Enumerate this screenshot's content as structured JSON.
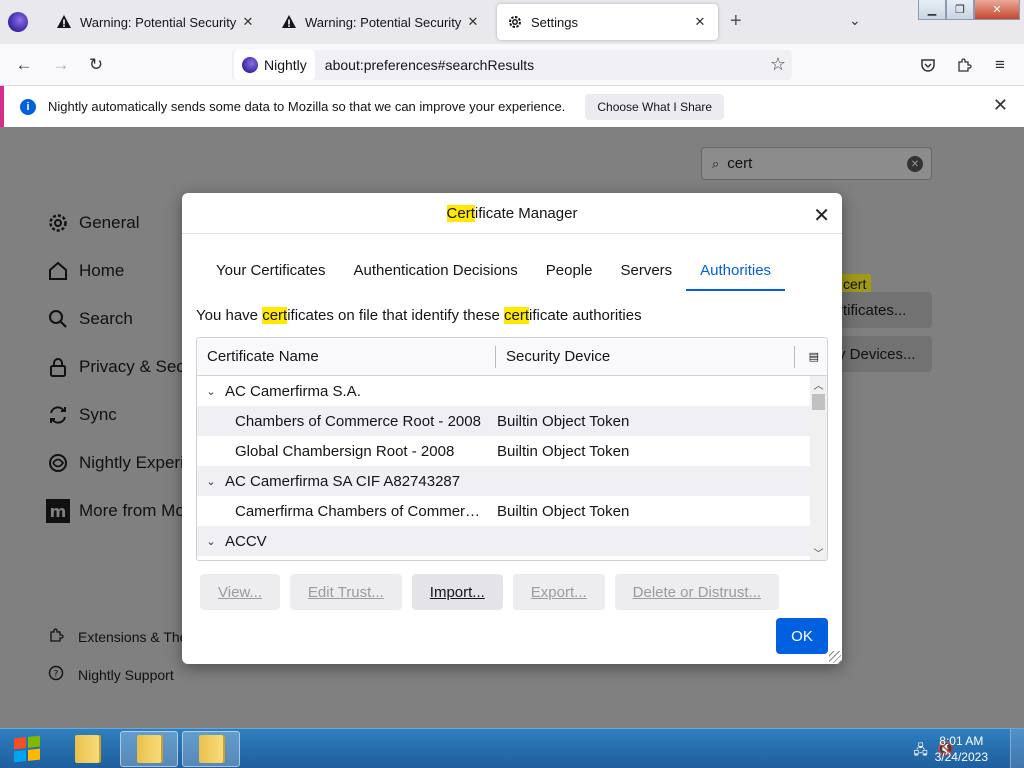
{
  "tabs": [
    {
      "title": "Warning: Potential Security Risk Ahead",
      "icon": "warning-icon"
    },
    {
      "title": "Warning: Potential Security Risk Ahead",
      "icon": "warning-icon"
    },
    {
      "title": "Settings",
      "icon": "gear-icon",
      "active": true
    }
  ],
  "navbar": {
    "identity_label": "Nightly",
    "url": "about:preferences#searchResults"
  },
  "notification": {
    "text": "Nightly automatically sends some data to Mozilla so that we can improve your experience.",
    "button": "Choose What I Share"
  },
  "settings": {
    "search_value": "cert",
    "categories": [
      {
        "label": "General",
        "icon": "gear-icon"
      },
      {
        "label": "Home",
        "icon": "home-icon"
      },
      {
        "label": "Search",
        "icon": "search-icon"
      },
      {
        "label": "Privacy & Secu",
        "icon": "lock-icon"
      },
      {
        "label": "Sync",
        "icon": "sync-icon"
      },
      {
        "label": "Nightly Experin",
        "icon": "flask-icon"
      },
      {
        "label": "More from Mo",
        "icon": "mozilla-icon"
      }
    ],
    "footer": [
      {
        "label": "Extensions & The",
        "icon": "puzzle-icon"
      },
      {
        "label": "Nightly Support",
        "icon": "help-icon"
      }
    ],
    "bg_badge": "cert",
    "bg_view_certs": "rtificates...",
    "bg_devices": "y Devices..."
  },
  "dialog": {
    "title_highlight": "Cert",
    "title_rest": "ificate Manager",
    "tabs": [
      "Your Certificates",
      "Authentication Decisions",
      "People",
      "Servers",
      "Authorities"
    ],
    "active_tab": "Authorities",
    "desc": {
      "p1": "You have ",
      "h1": "cert",
      "p2": "ificates on file that identify these ",
      "h2": "cert",
      "p3": "ificate authorities"
    },
    "columns": [
      "Certificate Name",
      "Security Device"
    ],
    "rows": [
      {
        "type": "group",
        "name": "AC Camerfirma S.A."
      },
      {
        "type": "cert",
        "name": "Chambers of Commerce Root - 2008",
        "device": "Builtin Object Token"
      },
      {
        "type": "cert",
        "name": "Global Chambersign Root - 2008",
        "device": "Builtin Object Token"
      },
      {
        "type": "group",
        "name": "AC Camerfirma SA CIF A82743287"
      },
      {
        "type": "cert",
        "name": "Camerfirma Chambers of Commerce ...",
        "device": "Builtin Object Token"
      },
      {
        "type": "group",
        "name": "ACCV"
      }
    ],
    "buttons": {
      "view": "View...",
      "edit_trust": "Edit Trust...",
      "import": "Import...",
      "export": "Export...",
      "delete": "Delete or Distrust..."
    },
    "ok": "OK"
  },
  "taskbar": {
    "time": "8:01 AM",
    "date": "3/24/2023"
  }
}
